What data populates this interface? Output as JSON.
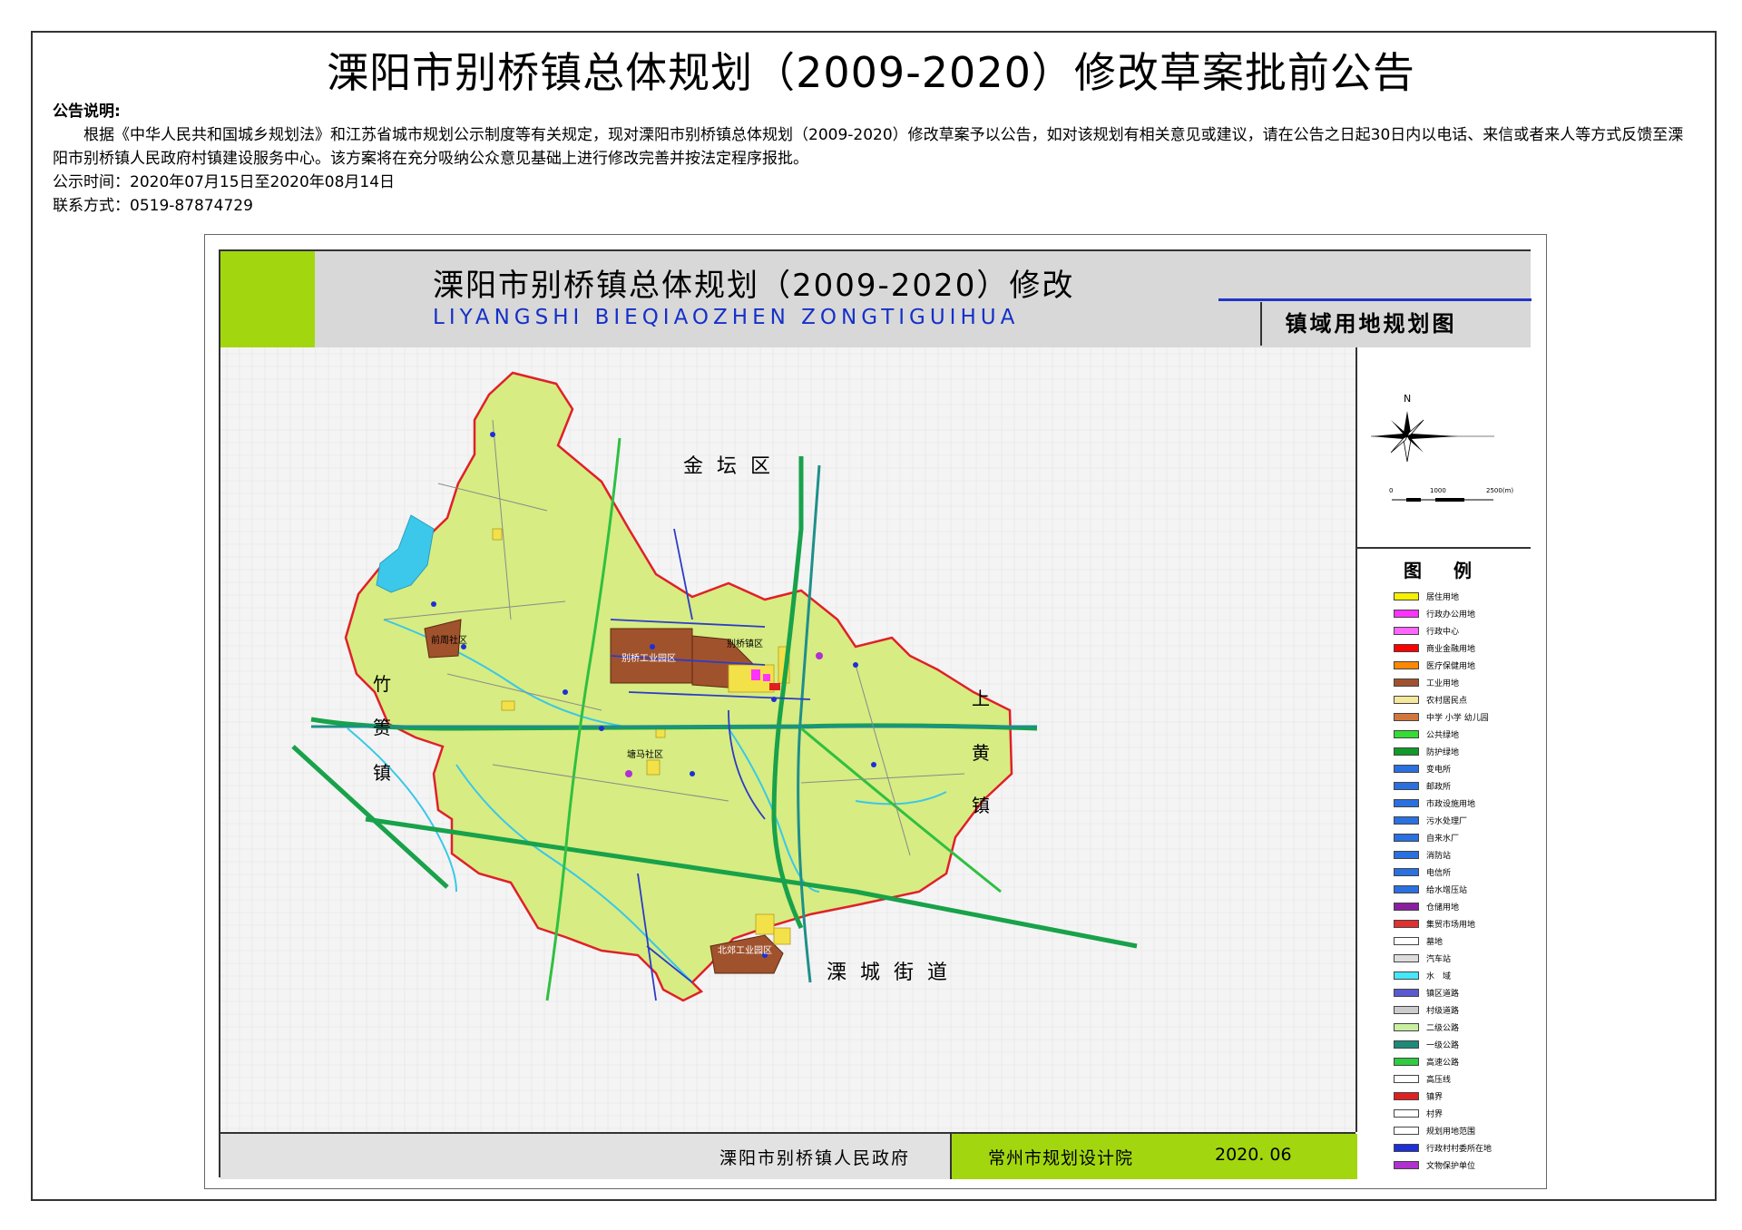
{
  "notice": {
    "title": "溧阳市别桥镇总体规划（2009-2020）修改草案批前公告",
    "label": "公告说明:",
    "body": "根据《中华人民共和国城乡规划法》和江苏省城市规划公示制度等有关规定，现对溧阳市别桥镇总体规划（2009-2020）修改草案予以公告，如对该规划有相关意见或建议，请在公告之日起30日内以电话、来信或者来人等方式反馈至溧阳市别桥镇人民政府村镇建设服务中心。该方案将在充分吸纳公众意见基础上进行修改完善并按法定程序报批。",
    "period": "公示时间：2020年07月15日至2020年08月14日",
    "contact": "联系方式：0519-87874729"
  },
  "plan": {
    "title": "溧阳市别桥镇总体规划（2009-2020）修改",
    "subtitle": "LIYANGSHI BIEQIAOZHEN ZONGTIGUIHUA",
    "map_name": "镇域用地规划图"
  },
  "map": {
    "place_labels": {
      "jintan": "金 坛 区",
      "zhuze_1": "竹",
      "zhuze_2": "箦",
      "zhuze_3": "镇",
      "shanghuang_1": "上",
      "shanghuang_2": "黄",
      "shanghuang_3": "镇",
      "licheng": "溧 城 街 道"
    },
    "area_labels": {
      "bieqiao_industrial": "别桥工业园区",
      "bieqiao_town": "别桥镇区",
      "beijiao_industrial": "北郊工业园区",
      "xiancun": "前周社区",
      "mid_community": "塘马社区"
    },
    "colors": {
      "town_fill": "#d6ec86",
      "boundary": "#e0202a",
      "water": "#38c8e8",
      "industrial": "#a0522d",
      "residential": "#f3e14a",
      "highway": "#18a24a",
      "road": "#2b3cc8"
    }
  },
  "compass": {
    "north": "N",
    "scale_0": "0",
    "scale_1": "1000",
    "scale_2": "2500(m)"
  },
  "legend": {
    "title": "图 例",
    "items": [
      {
        "label": "居住用地",
        "color": "#f7f000"
      },
      {
        "label": "行政办公用地",
        "color": "#ff33ff"
      },
      {
        "label": "行政中心",
        "color": "#ff66ff"
      },
      {
        "label": "商业金融用地",
        "color": "#ff0000"
      },
      {
        "label": "医疗保健用地",
        "color": "#ff8800"
      },
      {
        "label": "工业用地",
        "color": "#a0522d"
      },
      {
        "label": "农村居民点",
        "color": "#f5e89a"
      },
      {
        "label": "中学 小学 幼儿园",
        "color": "#d2773c"
      },
      {
        "label": "公共绿地",
        "color": "#33dd33"
      },
      {
        "label": "防护绿地",
        "color": "#119a2a"
      },
      {
        "label": "变电所",
        "color": "#2a70e0"
      },
      {
        "label": "邮政所",
        "color": "#2a70e0"
      },
      {
        "label": "市政设施用地",
        "color": "#2a70e0"
      },
      {
        "label": "污水处理厂",
        "color": "#2a70e0"
      },
      {
        "label": "自来水厂",
        "color": "#2a70e0"
      },
      {
        "label": "消防站",
        "color": "#2a70e0"
      },
      {
        "label": "电信所",
        "color": "#2a70e0"
      },
      {
        "label": "给水增压站",
        "color": "#2a70e0"
      },
      {
        "label": "仓储用地",
        "color": "#8a1fa0"
      },
      {
        "label": "集贸市场用地",
        "color": "#e03030"
      },
      {
        "label": "墓地",
        "color": "#ffffff"
      },
      {
        "label": "汽车站",
        "color": "#dddddd"
      },
      {
        "label": "水　域",
        "color": "#44e8f8"
      },
      {
        "label": "镇区道路",
        "color": "#5a5ad0"
      },
      {
        "label": "村级道路",
        "color": "#cccccc"
      },
      {
        "label": "二级公路",
        "color": "#c8f0a0"
      },
      {
        "label": "一级公路",
        "color": "#1d8a7a"
      },
      {
        "label": "高速公路",
        "color": "#2ecc40"
      },
      {
        "label": "高压线",
        "color": "#ffffff"
      },
      {
        "label": "镇界",
        "color": "#e02020"
      },
      {
        "label": "村界",
        "color": "#ffffff"
      },
      {
        "label": "规划用地范围",
        "color": "#ffffff"
      },
      {
        "label": "行政村村委所在地",
        "color": "#1d2fd6"
      },
      {
        "label": "文物保护单位",
        "color": "#b030d0"
      }
    ]
  },
  "footer": {
    "government": "溧阳市别桥镇人民政府",
    "institute": "常州市规划设计院",
    "date": "2020. 06"
  }
}
